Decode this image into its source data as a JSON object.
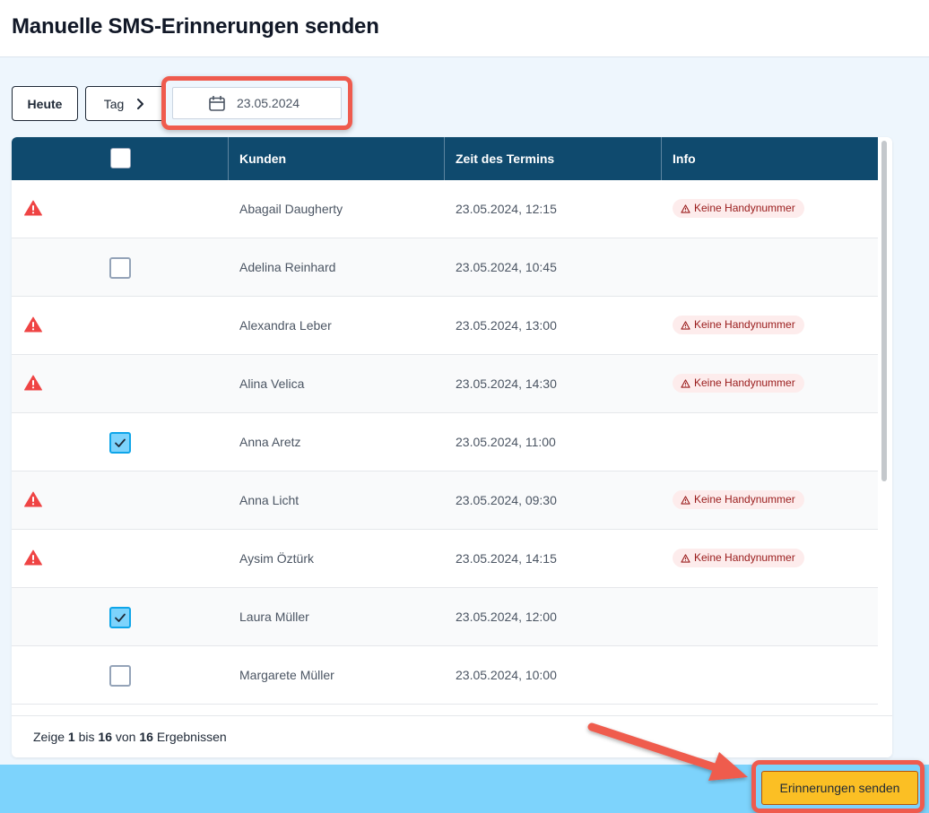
{
  "page_title": "Manuelle SMS-Erinnerungen senden",
  "toolbar": {
    "today_label": "Heute",
    "view_label": "Tag",
    "view_icon": "chevron-right-icon",
    "date_value": "23.05.2024",
    "date_icon": "calendar-icon"
  },
  "table": {
    "columns": [
      "",
      "Kunden",
      "Zeit des Termins",
      "Info"
    ],
    "rows": [
      {
        "warning": true,
        "checked": null,
        "name": "Abagail Daugherty",
        "time": "23.05.2024, 12:15",
        "info": "Keine Handynummer"
      },
      {
        "warning": false,
        "checked": false,
        "name": "Adelina Reinhard",
        "time": "23.05.2024, 10:45",
        "info": ""
      },
      {
        "warning": true,
        "checked": null,
        "name": "Alexandra Leber",
        "time": "23.05.2024, 13:00",
        "info": "Keine Handynummer"
      },
      {
        "warning": true,
        "checked": null,
        "name": "Alina Velica",
        "time": "23.05.2024, 14:30",
        "info": "Keine Handynummer"
      },
      {
        "warning": false,
        "checked": true,
        "name": "Anna Aretz",
        "time": "23.05.2024, 11:00",
        "info": ""
      },
      {
        "warning": true,
        "checked": null,
        "name": "Anna Licht",
        "time": "23.05.2024, 09:30",
        "info": "Keine Handynummer"
      },
      {
        "warning": true,
        "checked": null,
        "name": "Aysim Öztürk",
        "time": "23.05.2024, 14:15",
        "info": "Keine Handynummer"
      },
      {
        "warning": false,
        "checked": true,
        "name": "Laura Müller",
        "time": "23.05.2024, 12:00",
        "info": ""
      },
      {
        "warning": false,
        "checked": false,
        "name": "Margarete Müller",
        "time": "23.05.2024, 10:00",
        "info": ""
      }
    ]
  },
  "pagination": {
    "prefix": "Zeige",
    "from": "1",
    "to_word": "bis",
    "to": "16",
    "of_word": "von",
    "total": "16",
    "suffix": "Ergebnissen"
  },
  "actions": {
    "send_label": "Erinnerungen senden"
  },
  "colors": {
    "header_bg": "#0f4a6e",
    "accent": "#fbbf24",
    "warning": "#ef4444",
    "highlight": "#ef5b4e",
    "bottom_bar": "#7dd3fc"
  }
}
